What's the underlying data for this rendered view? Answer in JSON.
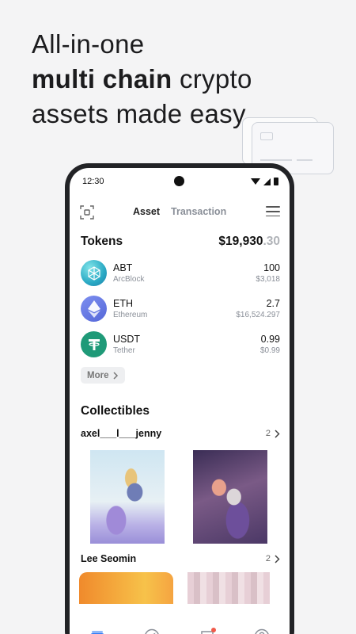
{
  "headline": {
    "line1": "All-in-one",
    "line2_bold": "multi chain",
    "line2_rest": " crypto",
    "line3": "assets made easy"
  },
  "status_bar": {
    "time": "12:30"
  },
  "topbar": {
    "tab_asset": "Asset",
    "tab_transaction": "Transaction"
  },
  "tokens": {
    "title": "Tokens",
    "balance_main": "$19,930",
    "balance_decimal": ".30",
    "items": [
      {
        "symbol": "ABT",
        "name": "ArcBlock",
        "amount": "100",
        "usd": "$3,018",
        "icon": "arcblock-icon"
      },
      {
        "symbol": "ETH",
        "name": "Ethereum",
        "amount": "2.7",
        "usd": "$16,524.297",
        "icon": "ethereum-icon"
      },
      {
        "symbol": "USDT",
        "name": "Tether",
        "amount": "0.99",
        "usd": "$0.99",
        "icon": "tether-icon"
      }
    ],
    "more_label": "More"
  },
  "collectibles": {
    "title": "Collectibles",
    "groups": [
      {
        "owner": "axel___l___jenny",
        "count": "2"
      },
      {
        "owner": "Lee Seomin",
        "count": "2"
      }
    ]
  },
  "nav": {
    "items": [
      "wallet-icon",
      "compass-icon",
      "chat-icon",
      "profile-icon"
    ],
    "accent": "#2f7cf6",
    "badge_color": "#f05a4a"
  }
}
